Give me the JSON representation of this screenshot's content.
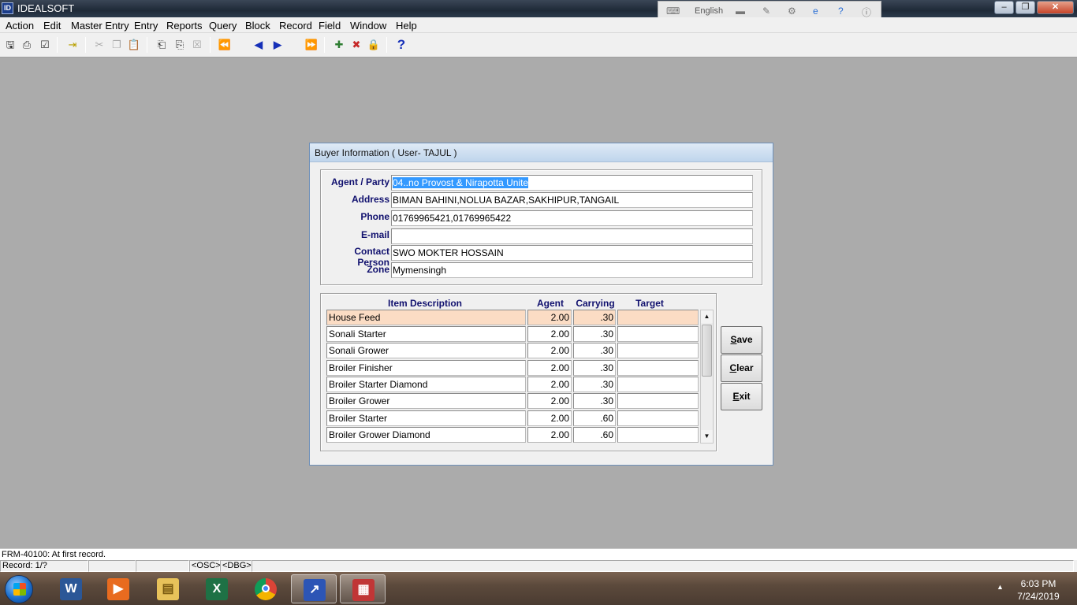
{
  "window": {
    "title": "IDEALSOFT",
    "app_icon": "idealsoft-app-icon"
  },
  "language_bar": {
    "language": "English"
  },
  "menu": [
    "Action",
    "Edit",
    "Master Entry",
    "Entry",
    "Reports",
    "Query",
    "Block",
    "Record",
    "Field",
    "Window",
    "Help"
  ],
  "toolbar": {
    "help_glyph": "?"
  },
  "dialog": {
    "title": "Buyer Information ( User- TAJUL )",
    "labels": {
      "agent_party": "Agent / Party",
      "address": "Address",
      "phone": "Phone",
      "email": "E-mail",
      "contact_person": "Contact Person",
      "zone": "Zone"
    },
    "values": {
      "agent_party": "04..no Provost & Nirapotta Unite",
      "address": "BIMAN BAHINI,NOLUA BAZAR,SAKHIPUR,TANGAIL",
      "phone": "01769965421,01769965422",
      "email": "",
      "contact_person": "SWO MOKTER HOSSAIN",
      "zone": "Mymensingh"
    },
    "columns": [
      "Item Description",
      "Agent",
      "Carrying",
      "Target"
    ],
    "rows": [
      {
        "item": "House Feed",
        "agent": "2.00",
        "carrying": ".30",
        "target": ""
      },
      {
        "item": "Sonali Starter",
        "agent": "2.00",
        "carrying": ".30",
        "target": ""
      },
      {
        "item": "Sonali Grower",
        "agent": "2.00",
        "carrying": ".30",
        "target": ""
      },
      {
        "item": "Broiler Finisher",
        "agent": "2.00",
        "carrying": ".30",
        "target": ""
      },
      {
        "item": "Broiler Starter Diamond",
        "agent": "2.00",
        "carrying": ".30",
        "target": ""
      },
      {
        "item": "Broiler Grower",
        "agent": "2.00",
        "carrying": ".30",
        "target": ""
      },
      {
        "item": "Broiler Starter",
        "agent": "2.00",
        "carrying": ".60",
        "target": ""
      },
      {
        "item": "Broiler Grower Diamond",
        "agent": "2.00",
        "carrying": ".60",
        "target": ""
      }
    ],
    "buttons": {
      "save": {
        "key": "S",
        "rest": "ave"
      },
      "clear": {
        "key": "C",
        "rest": "lear"
      },
      "exit": {
        "key": "E",
        "rest": "xit"
      }
    }
  },
  "status": {
    "message": "FRM-40100: At first record.",
    "record": "Record: 1/?",
    "osc": "<OSC>",
    "dbg": "<DBG>"
  },
  "taskbar": {
    "time": "6:03 PM",
    "date": "7/24/2019"
  },
  "colors": {
    "label_text": "#10106e",
    "current_row": "#fbdcc4",
    "selection": "#3399ff",
    "workspace": "#ababab"
  }
}
